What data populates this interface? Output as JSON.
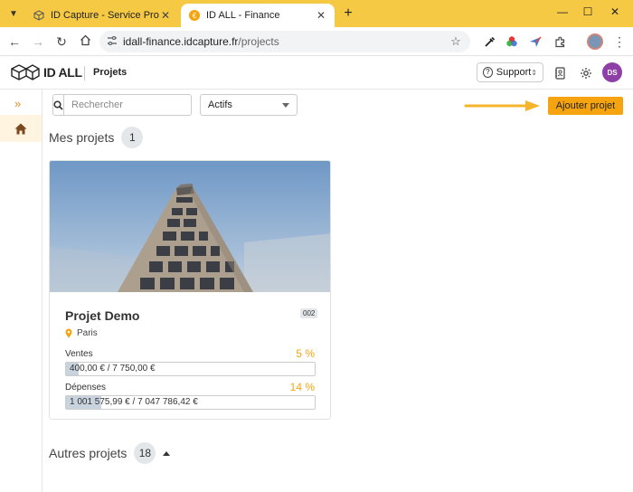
{
  "browser": {
    "tabs": [
      {
        "title": "ID Capture - Service Production",
        "icon": "id-capture-favicon"
      },
      {
        "title": "ID ALL - Finance",
        "icon": "id-all-favicon"
      }
    ],
    "url": {
      "host": "idall-finance.idcapture.fr",
      "path": "/projects"
    }
  },
  "header": {
    "logo_text": "ID ALL",
    "section": "Projets",
    "support_label": "Support",
    "avatar_initials": "DS"
  },
  "filters": {
    "search_placeholder": "Rechercher",
    "status_selected": "Actifs"
  },
  "actions": {
    "add_project_label": "Ajouter projet"
  },
  "my_projects": {
    "title": "Mes projets",
    "count": "1",
    "projects": [
      {
        "name": "Projet Demo",
        "code": "002",
        "location": "Paris",
        "sales": {
          "label": "Ventes",
          "percent": "5 %",
          "fraction": 0.05,
          "amount": "400,00 € / 7 750,00 €"
        },
        "expenses": {
          "label": "Dépenses",
          "percent": "14 %",
          "fraction": 0.14,
          "amount": "1 001 575,99 € / 7 047 786,42 €"
        }
      }
    ]
  },
  "other_projects": {
    "title": "Autres projets",
    "count": "18"
  },
  "colors": {
    "accent": "#f5a40f",
    "avatar": "#8e3fa8",
    "tabbar": "#f6c945"
  }
}
